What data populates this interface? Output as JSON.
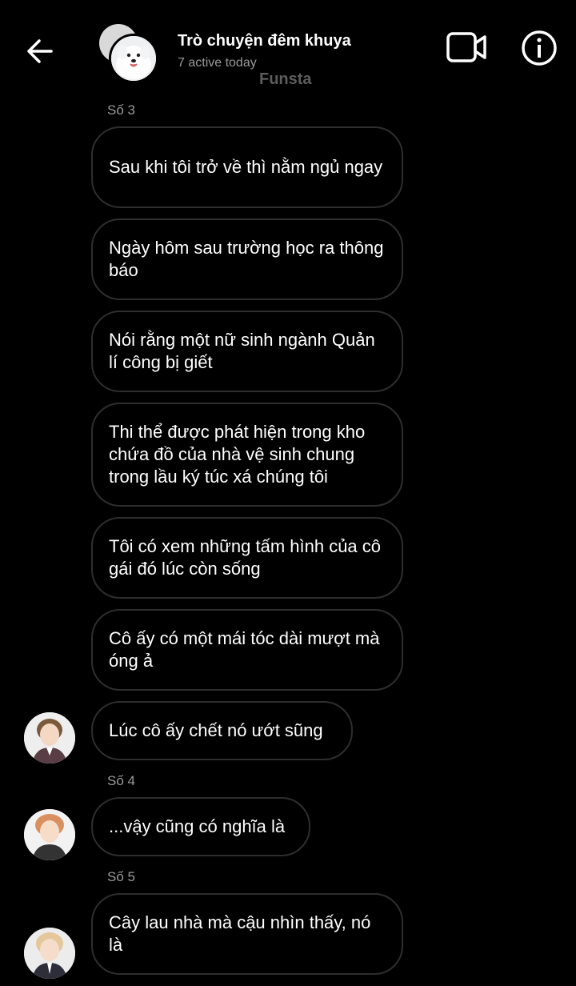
{
  "header": {
    "title": "Trò chuyện đêm khuya",
    "subtitle": "7 active today",
    "watermark": "Funsta"
  },
  "icons": {
    "back": "arrow-left-icon",
    "video": "video-camera-icon",
    "info": "info-circle-icon"
  },
  "colors": {
    "background": "#000000",
    "bubble_border": "#2e2e2e",
    "muted_text": "#9a9a9a"
  },
  "messages": [
    {
      "label": "Số 3"
    },
    {
      "text": "Sau khi tôi trở về thì nằm ngủ ngay"
    },
    {
      "text": "Ngày hôm sau trường học ra thông báo"
    },
    {
      "text": "Nói rằng một nữ sinh ngành Quản lí công bị giết"
    },
    {
      "text": "Thi thể được phát hiện trong kho chứa đồ của nhà vệ sinh chung trong lầu ký túc xá chúng tôi"
    },
    {
      "text": "Tôi có xem những tấm hình của cô gái đó lúc còn sống"
    },
    {
      "text": "Cô ấy có một mái tóc dài mượt mà óng ả"
    },
    {
      "text": "Lúc cô ấy chết nó ướt sũng"
    },
    {
      "label": "Số 4"
    },
    {
      "text": "...vậy cũng có nghĩa là"
    },
    {
      "label": "Số 5"
    },
    {
      "text": "Cây lau nhà mà cậu nhìn thấy, nó là"
    }
  ]
}
